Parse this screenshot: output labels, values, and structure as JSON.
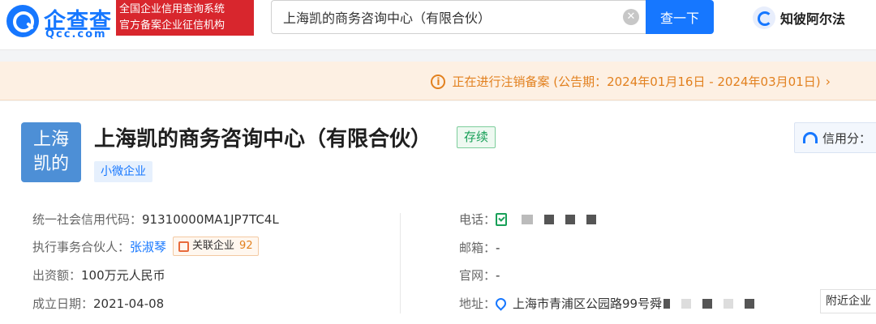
{
  "header": {
    "logo_text": "企查查",
    "logo_subtext": "Qcc.com",
    "brand_badge_line1": "全国企业信用查询系统",
    "brand_badge_line2": "官方备案企业征信机构",
    "search_value": "上海凯的商务咨询中心（有限合伙）",
    "search_button": "查一下",
    "partner_label": "知彼阿尔法"
  },
  "notice": {
    "text": "正在进行注销备案 (公告期：2024年01月16日 - 2024年03月01日)"
  },
  "company": {
    "logo_line1": "上海",
    "logo_line2": "凯的",
    "name": "上海凯的商务咨询中心（有限合伙）",
    "status": "存续",
    "scale": "小微企业",
    "credit_label": "信用分："
  },
  "details": {
    "credit_code_label": "统一社会信用代码：",
    "credit_code_value": "91310000MA1JP7TC4L",
    "partner_label": "执行事务合伙人：",
    "partner_value": "张淑琴",
    "related_label": "关联企业",
    "related_count": "92",
    "capital_label": "出资额：",
    "capital_value": "100万元人民币",
    "founded_label": "成立日期：",
    "founded_value": "2021-04-08",
    "phone_label": "电话：",
    "email_label": "邮箱：",
    "email_value": "-",
    "website_label": "官网：",
    "website_value": "-",
    "address_label": "地址：",
    "address_value": "上海市青浦区公园路99号舜",
    "nearby_button": "附近企业"
  },
  "colors": {
    "primary": "#1677ff",
    "brand_red": "#d8262d",
    "notice_orange": "#e2801e",
    "status_green": "#18a058"
  }
}
